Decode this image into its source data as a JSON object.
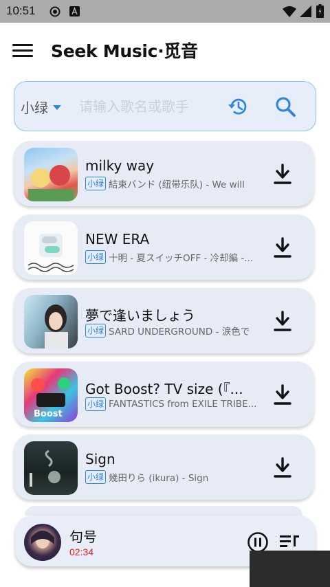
{
  "status_bar": {
    "time": "10:51",
    "icons": [
      "record-icon",
      "a-badge-icon",
      "wifi-icon",
      "signal-icon",
      "battery-icon"
    ]
  },
  "app_bar": {
    "title": "Seek Music·觅音",
    "menu_icon": "hamburger-menu-icon"
  },
  "search": {
    "source": "小绿",
    "placeholder": "请输入歌名或歌手",
    "value": "",
    "history_icon": "history-icon",
    "search_icon": "search-icon",
    "accent_color": "#2e86de"
  },
  "songs": [
    {
      "title": "milky way",
      "source": "小绿",
      "meta": "結束バンド (纽带乐队) - We will",
      "cover": "cover-art-1"
    },
    {
      "title": "NEW ERA",
      "source": "小绿",
      "meta": "十明 - 夏スイッチOFF - 冷却編 -...",
      "cover": "cover-art-2"
    },
    {
      "title": "夢で逢いましょう",
      "source": "小绿",
      "meta": "SARD UNDERGROUND - 涙色で",
      "cover": "cover-art-3"
    },
    {
      "title": "Got Boost?  TV size (『...",
      "source": "小绿",
      "meta": "FANTASTICS from EXILE TRIBE...",
      "cover": "cover-art-4"
    },
    {
      "title": "Sign",
      "source": "小绿",
      "meta": "幾田りら (ikura) - Sign",
      "cover": "cover-art-5"
    }
  ],
  "player": {
    "title": "句号",
    "time": "02:34",
    "time_color": "#e21b1b",
    "pause_icon": "pause-icon",
    "queue_icon": "queue-list-icon"
  }
}
